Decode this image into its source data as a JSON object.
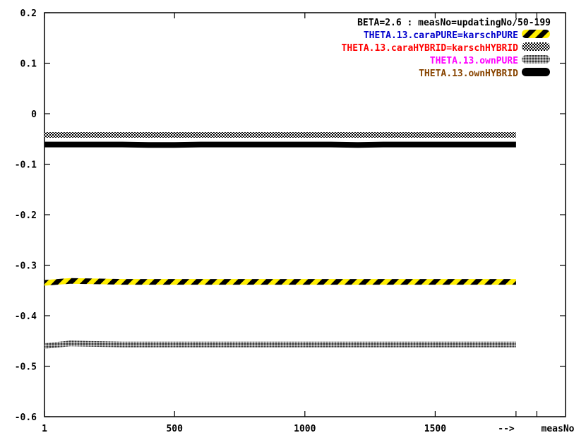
{
  "chart_data": {
    "type": "line",
    "title": "BETA=2.6 : measNo=updatingNo/50-199",
    "xlabel": "measNo",
    "x_arrow_label": "-->",
    "xlim": [
      1,
      2000
    ],
    "ylim": [
      -0.6,
      0.2
    ],
    "x_ticks": [
      {
        "value": 1,
        "label": "1"
      },
      {
        "value": 500,
        "label": "500"
      },
      {
        "value": 1000,
        "label": "1000"
      },
      {
        "value": 1500,
        "label": "1500"
      }
    ],
    "y_ticks": [
      {
        "value": 0.2,
        "label": "0.2"
      },
      {
        "value": 0.1,
        "label": "0.1"
      },
      {
        "value": 0,
        "label": "0"
      },
      {
        "value": -0.1,
        "label": "-0.1"
      },
      {
        "value": -0.2,
        "label": "-0.2"
      },
      {
        "value": -0.3,
        "label": "-0.3"
      },
      {
        "value": -0.4,
        "label": "-0.4"
      },
      {
        "value": -0.5,
        "label": "-0.5"
      },
      {
        "value": -0.6,
        "label": "-0.6"
      }
    ],
    "grid": false,
    "legend_position": "top-right",
    "series": [
      {
        "name": "THETA.13.caraPURE=karschPURE",
        "color": "#0000cc",
        "pattern": "yellow-black-stripes",
        "x": [
          1,
          100,
          200,
          300,
          400,
          500,
          600,
          700,
          800,
          900,
          1000,
          1100,
          1200,
          1300,
          1400,
          1500,
          1600,
          1700,
          1810
        ],
        "y": [
          -0.335,
          -0.331,
          -0.332,
          -0.333,
          -0.333,
          -0.333,
          -0.333,
          -0.333,
          -0.333,
          -0.333,
          -0.333,
          -0.333,
          -0.333,
          -0.333,
          -0.333,
          -0.333,
          -0.333,
          -0.333,
          -0.333
        ]
      },
      {
        "name": "THETA.13.caraHYBRID=karschHYBRID",
        "color": "#ff0000",
        "pattern": "checker",
        "x": [
          1,
          100,
          200,
          300,
          400,
          500,
          600,
          700,
          800,
          900,
          1000,
          1100,
          1200,
          1300,
          1400,
          1500,
          1600,
          1700,
          1810
        ],
        "y": [
          -0.042,
          -0.042,
          -0.042,
          -0.042,
          -0.042,
          -0.042,
          -0.042,
          -0.042,
          -0.042,
          -0.042,
          -0.042,
          -0.042,
          -0.042,
          -0.042,
          -0.042,
          -0.042,
          -0.042,
          -0.042,
          -0.042
        ]
      },
      {
        "name": "THETA.13.ownPURE",
        "color": "#ff00ff",
        "pattern": "gray-dots",
        "x": [
          1,
          100,
          200,
          300,
          400,
          500,
          600,
          700,
          800,
          900,
          1000,
          1100,
          1200,
          1300,
          1400,
          1500,
          1600,
          1700,
          1810
        ],
        "y": [
          -0.46,
          -0.455,
          -0.456,
          -0.457,
          -0.457,
          -0.457,
          -0.457,
          -0.457,
          -0.457,
          -0.457,
          -0.457,
          -0.457,
          -0.457,
          -0.457,
          -0.457,
          -0.457,
          -0.457,
          -0.457,
          -0.457
        ]
      },
      {
        "name": "THETA.13.ownHYBRID",
        "color": "#884400",
        "pattern": "solid-black",
        "x": [
          1,
          100,
          200,
          300,
          400,
          500,
          600,
          700,
          800,
          900,
          1000,
          1100,
          1200,
          1300,
          1400,
          1500,
          1600,
          1700,
          1810
        ],
        "y": [
          -0.061,
          -0.061,
          -0.061,
          -0.061,
          -0.062,
          -0.062,
          -0.061,
          -0.061,
          -0.061,
          -0.061,
          -0.061,
          -0.061,
          -0.062,
          -0.061,
          -0.061,
          -0.061,
          -0.061,
          -0.061,
          -0.061
        ]
      }
    ]
  }
}
